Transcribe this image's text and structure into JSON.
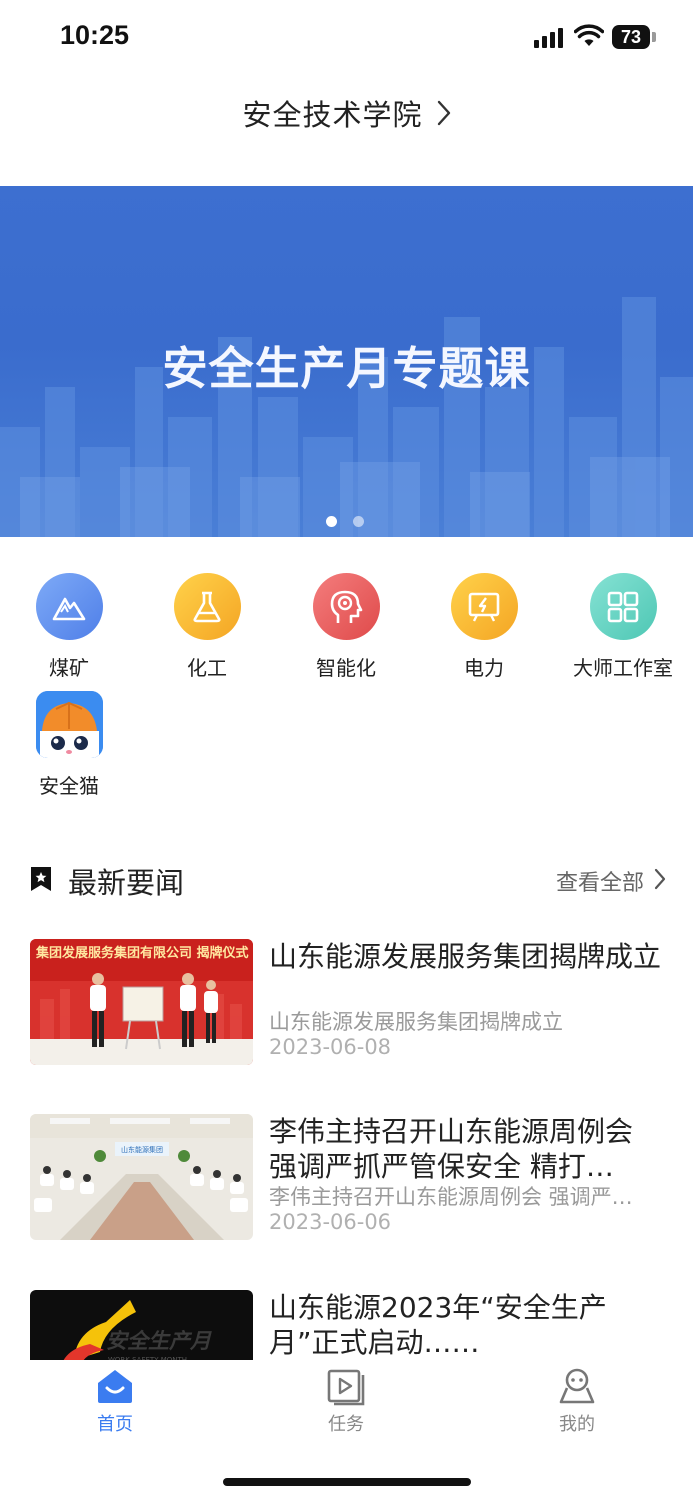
{
  "status_bar": {
    "time": "10:25",
    "battery": "73"
  },
  "header": {
    "title": "安全技术学院"
  },
  "banner": {
    "title": "安全生产月专题课",
    "slides": 2,
    "active_slide": 1
  },
  "categories": [
    {
      "label": "煤矿",
      "icon": "mountain-icon",
      "color": "#5b8ff0"
    },
    {
      "label": "化工",
      "icon": "flask-icon",
      "color": "#f7b733"
    },
    {
      "label": "智能化",
      "icon": "brain-icon",
      "color": "#ea5a5a"
    },
    {
      "label": "电力",
      "icon": "power-board-icon",
      "color": "#f7b733"
    },
    {
      "label": "大师工作室",
      "icon": "grid-icon",
      "color": "#5ed1c0"
    },
    {
      "label": "安全猫",
      "icon": "safety-cat-icon",
      "color": "#f28c2a"
    }
  ],
  "news": {
    "section_title": "最新要闻",
    "view_all": "查看全部",
    "items": [
      {
        "headline": "山东能源发展服务集团揭牌成立",
        "summary": "山东能源发展服务集团揭牌成立",
        "date": "2023-06-08",
        "thumb_text": "集团发展服务集团有限公司 揭牌仪式"
      },
      {
        "headline": "李伟主持召开山东能源周例会 强调严抓严管保安全 精打…",
        "summary": "李伟主持召开山东能源周例会 强调严…",
        "date": "2023-06-06",
        "thumb_text": "山东能源集团"
      },
      {
        "headline": "山东能源2023年“安全生产月”正式启动……",
        "summary": "",
        "date": "",
        "thumb_text": "安全生产月",
        "thumb_subtext": "WORK SAFETY MONTH"
      }
    ]
  },
  "tabs": [
    {
      "label": "首页",
      "icon": "home-icon",
      "active": true
    },
    {
      "label": "任务",
      "icon": "task-video-icon",
      "active": false
    },
    {
      "label": "我的",
      "icon": "profile-icon",
      "active": false
    }
  ],
  "colors": {
    "accent": "#3b7cf0",
    "inactive": "#888888",
    "banner": "#3d6fd0"
  }
}
